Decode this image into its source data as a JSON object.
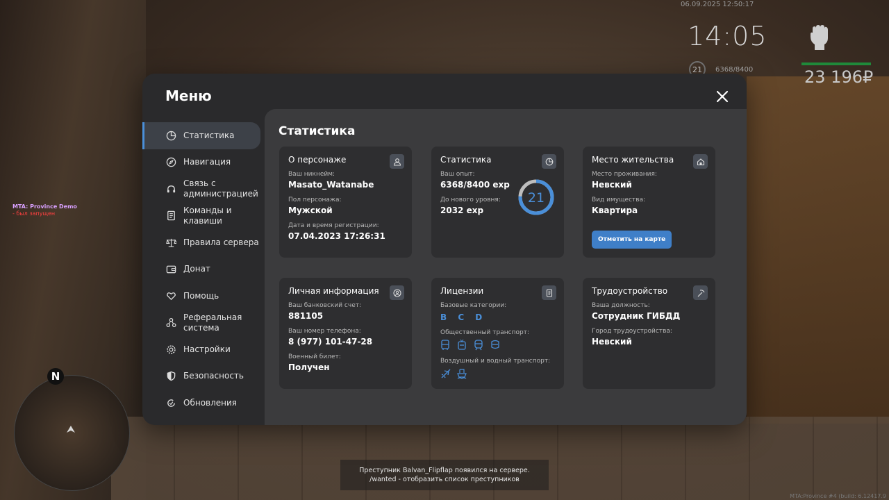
{
  "hud": {
    "datetime": "06.09.2025 12:50:17",
    "clock": "14:05",
    "level": "21",
    "exp": "6368/8400",
    "money": "23 196₽"
  },
  "chat": {
    "line1": "MTA: Province Demo",
    "line2": "- был запущен"
  },
  "minimap": {
    "north": "N"
  },
  "notification": {
    "line1": "Преступник Balvan_Flipflap появился на сервере.",
    "line2": "/wanted - отобразить список преступников"
  },
  "build": "MTA:Province #4 (build: 6.12417.9",
  "menu": {
    "title": "Меню",
    "sidebar": [
      {
        "label": "Статистика",
        "icon": "pie-chart-icon",
        "active": true
      },
      {
        "label": "Навигация",
        "icon": "compass-icon"
      },
      {
        "label": "Связь с администрацией",
        "icon": "headset-icon"
      },
      {
        "label": "Команды и клавиши",
        "icon": "document-icon"
      },
      {
        "label": "Правила сервера",
        "icon": "scales-icon"
      },
      {
        "label": "Донат",
        "icon": "wallet-icon"
      },
      {
        "label": "Помощь",
        "icon": "heart-hands-icon"
      },
      {
        "label": "Реферальная система",
        "icon": "network-icon"
      },
      {
        "label": "Настройки",
        "icon": "gear-icon"
      },
      {
        "label": "Безопасность",
        "icon": "shield-icon"
      },
      {
        "label": "Обновления",
        "icon": "refresh-icon"
      }
    ],
    "content_title": "Статистика",
    "cards": {
      "character": {
        "title": "О персонаже",
        "nickname_label": "Ваш никнейм:",
        "nickname": "Masato_Watanabe",
        "gender_label": "Пол персонажа:",
        "gender": "Мужской",
        "reg_label": "Дата и время регистрации:",
        "reg": "07.04.2023 17:26:31"
      },
      "stats": {
        "title": "Статистика",
        "exp_label": "Ваш опыт:",
        "exp": "6368/8400 exp",
        "next_label": "До нового уровня:",
        "next": "2032 exp",
        "level": "21",
        "progress": 0.758
      },
      "residence": {
        "title": "Место жительства",
        "place_label": "Место проживания:",
        "place": "Невский",
        "property_label": "Вид имущества:",
        "property": "Квартира",
        "button": "Отметить на карте"
      },
      "personal": {
        "title": "Личная информация",
        "bank_label": "Ваш банковский счет:",
        "bank": "881105",
        "phone_label": "Ваш номер телефона:",
        "phone": "8 (977) 101-47-28",
        "military_label": "Военный билет:",
        "military": "Получен"
      },
      "licenses": {
        "title": "Лицензии",
        "base_label": "Базовые категории:",
        "base": "B C D",
        "public_label": "Общественный транспорт:",
        "air_label": "Воздушный и водный транспорт:"
      },
      "job": {
        "title": "Трудоустройство",
        "position_label": "Ваша должность:",
        "position": "Сотрудник ГИБДД",
        "city_label": "Город трудоустройства:",
        "city": "Невский"
      }
    }
  },
  "colors": {
    "accent": "#4a8fd9",
    "panel": "#2a2a2c",
    "card": "#2e2e30",
    "money_bar": "#1f8a3a"
  }
}
